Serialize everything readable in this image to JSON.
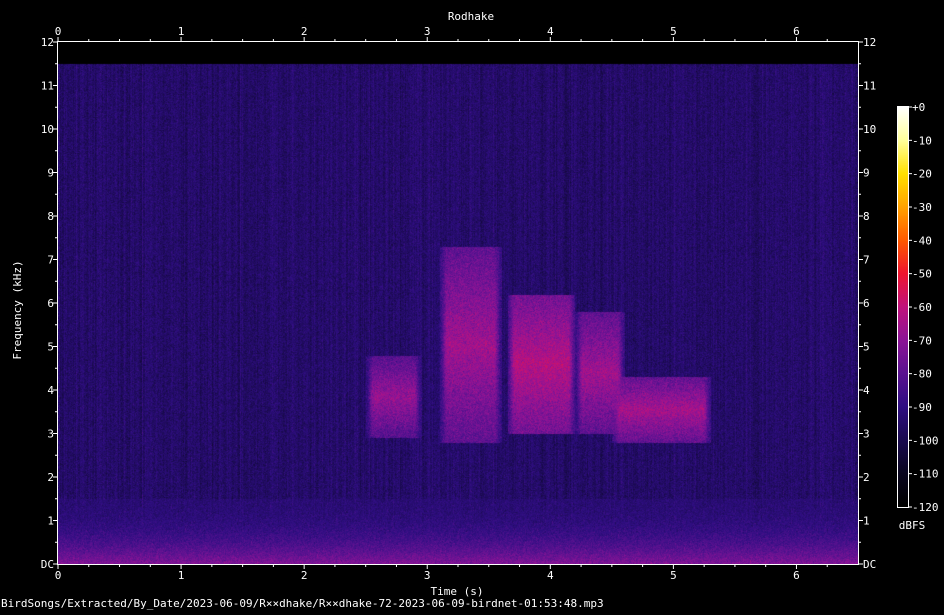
{
  "chart_data": {
    "type": "heatmap",
    "title": "Rodhake",
    "xlabel": "Time (s)",
    "ylabel": "Frequency (kHz)",
    "xlim": [
      0,
      6.5
    ],
    "ylim": [
      0,
      12
    ],
    "x_ticks": [
      0,
      1,
      2,
      3,
      4,
      5,
      6
    ],
    "x_tick_labels": [
      "0",
      "1",
      "2",
      "3",
      "4",
      "5",
      "6"
    ],
    "y_ticks": [
      0,
      1,
      2,
      3,
      4,
      5,
      6,
      7,
      8,
      9,
      10,
      11,
      12
    ],
    "y_tick_labels": [
      "DC",
      "1",
      "2",
      "3",
      "4",
      "5",
      "6",
      "7",
      "8",
      "9",
      "10",
      "11",
      "12"
    ],
    "colorbar": {
      "label": "dBFS",
      "range": [
        -120,
        0
      ],
      "ticks": [
        0,
        -10,
        -20,
        -30,
        -40,
        -50,
        -60,
        -70,
        -80,
        -90,
        -100,
        -110,
        -120
      ],
      "tick_labels": [
        "+0",
        "-10",
        "-20",
        "-30",
        "-40",
        "-50",
        "-60",
        "-70",
        "-80",
        "-90",
        "-100",
        "-110",
        "-120"
      ],
      "colormap": [
        "#000000",
        "#0a0620",
        "#1a0a50",
        "#2f0e82",
        "#5a1290",
        "#8c1496",
        "#c0127c",
        "#ee1530",
        "#ff5a00",
        "#ffa200",
        "#ffe000",
        "#ffff9a",
        "#ffffff"
      ]
    },
    "noise_floor_db": -95,
    "signal_top_khz": 11.5,
    "calls": [
      {
        "t_start": 2.5,
        "t_end": 2.95,
        "f_low": 2.9,
        "f_high": 4.8,
        "peak_db": -68
      },
      {
        "t_start": 3.1,
        "t_end": 3.6,
        "f_low": 2.8,
        "f_high": 7.3,
        "peak_db": -66
      },
      {
        "t_start": 3.65,
        "t_end": 4.2,
        "f_low": 3.0,
        "f_high": 6.2,
        "peak_db": -62
      },
      {
        "t_start": 4.2,
        "t_end": 4.6,
        "f_low": 3.0,
        "f_high": 5.8,
        "peak_db": -66
      },
      {
        "t_start": 4.5,
        "t_end": 5.3,
        "f_low": 2.8,
        "f_high": 4.3,
        "peak_db": -65
      }
    ],
    "low_frequency_band": {
      "f_low": 0,
      "f_high": 1.5,
      "peak_db": -72
    }
  },
  "footer": {
    "file_path": "BirdSongs/Extracted/By_Date/2023-06-09/R××dhake/R××dhake-72-2023-06-09-birdnet-01:53:48.mp3"
  }
}
